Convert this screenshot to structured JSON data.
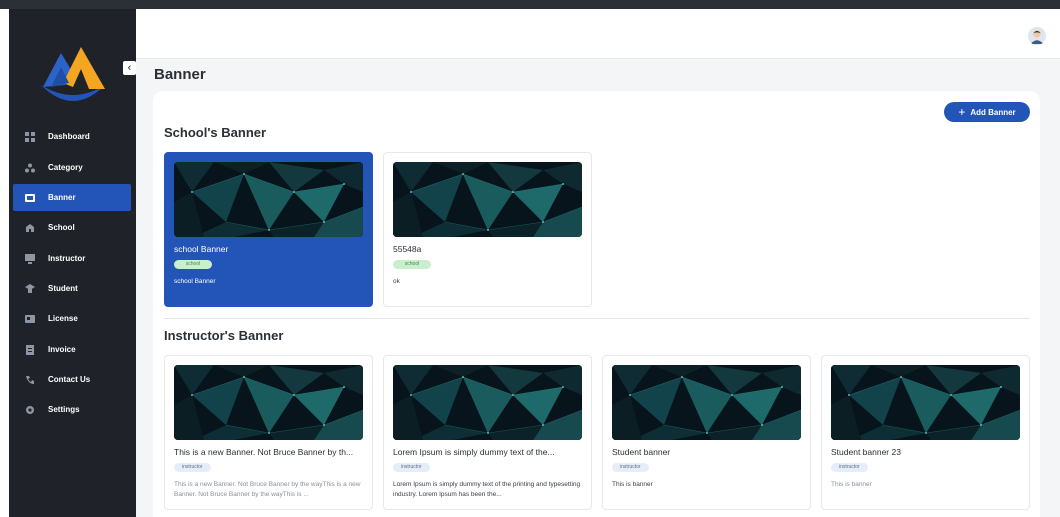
{
  "sidebar": {
    "collapse_icon": "chevron-left-icon",
    "items": [
      {
        "label": "Dashboard",
        "icon": "dashboard-icon"
      },
      {
        "label": "Category",
        "icon": "category-icon"
      },
      {
        "label": "Banner",
        "icon": "banner-icon",
        "active": true
      },
      {
        "label": "School",
        "icon": "school-icon"
      },
      {
        "label": "Instructor",
        "icon": "instructor-icon"
      },
      {
        "label": "Student",
        "icon": "student-icon"
      },
      {
        "label": "License",
        "icon": "license-icon"
      },
      {
        "label": "Invoice",
        "icon": "invoice-icon"
      },
      {
        "label": "Contact Us",
        "icon": "phone-icon"
      },
      {
        "label": "Settings",
        "icon": "gear-icon"
      }
    ]
  },
  "header": {
    "avatar_icon": "user-avatar-icon"
  },
  "page": {
    "title": "Banner",
    "add_button": "Add Banner"
  },
  "school_section": {
    "title": "School's Banner",
    "cards": [
      {
        "title": "school Banner",
        "tag": "school",
        "description": "school Banner",
        "selected": true
      },
      {
        "title": "55548a",
        "tag": "school",
        "description": "ok"
      }
    ]
  },
  "instructor_section": {
    "title": "Instructor's Banner",
    "cards": [
      {
        "title": "This is a new Banner. Not Bruce Banner by th...",
        "tag": "instructor",
        "description": "This is a new Banner. Not Bruce Banner by the wayThis is a new Banner. Not Bruce Banner by the wayThis is ..."
      },
      {
        "title": "Lorem Ipsum is simply dummy text of the...",
        "tag": "instructor",
        "description": "Lorem Ipsum is simply dummy text of the printing and typesetting industry. Lorem Ipsum has been the..."
      },
      {
        "title": "Student banner",
        "tag": "instructor",
        "description": "This is banner"
      },
      {
        "title": "Student banner 23",
        "tag": "instructor",
        "description": "This is banner"
      }
    ]
  },
  "colors": {
    "sidebar_bg": "#1f2329",
    "accent": "#2355b8",
    "school_tag": "#c9efcf",
    "instructor_tag": "#e6edf8"
  }
}
